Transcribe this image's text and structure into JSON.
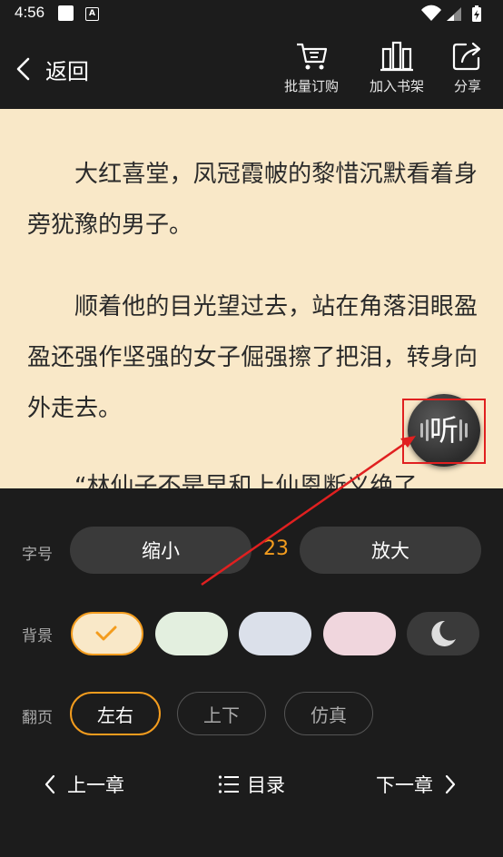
{
  "status_bar": {
    "time": "4:56"
  },
  "header": {
    "back_label": "返回",
    "tools": [
      {
        "label": "批量订购",
        "icon": "cart-icon"
      },
      {
        "label": "加入书架",
        "icon": "bookshelf-icon"
      },
      {
        "label": "分享",
        "icon": "share-icon"
      }
    ]
  },
  "reader": {
    "paragraphs": [
      "大红喜堂，凤冠霞帔的黎惜沉默看着身旁犹豫的男子。",
      "顺着他的目光望过去，站在角落泪眼盈盈还强作坚强的女子倔强擦了把泪，转身向外走去。",
      "“林仙子不是早和上仙恩断义绝了"
    ],
    "listen_label": "听"
  },
  "settings": {
    "font": {
      "label": "字号",
      "decrease": "缩小",
      "value": "23",
      "increase": "放大"
    },
    "background": {
      "label": "背景",
      "swatches": [
        {
          "color": "#f9e8c8",
          "selected": true
        },
        {
          "color": "#e3efdf",
          "selected": false
        },
        {
          "color": "#dbe0ea",
          "selected": false
        },
        {
          "color": "#f0d6dd",
          "selected": false
        },
        {
          "color": "#3a3a3a",
          "selected": false,
          "icon": "moon-icon"
        }
      ]
    },
    "page_turn": {
      "label": "翻页",
      "options": [
        {
          "label": "左右",
          "active": true
        },
        {
          "label": "上下",
          "active": false
        },
        {
          "label": "仿真",
          "active": false
        }
      ]
    },
    "nav": {
      "prev": "上一章",
      "toc": "目录",
      "next": "下一章"
    }
  },
  "colors": {
    "accent": "#f39c1e",
    "annotation": "#e02020",
    "paper": "#f9e8c8"
  }
}
